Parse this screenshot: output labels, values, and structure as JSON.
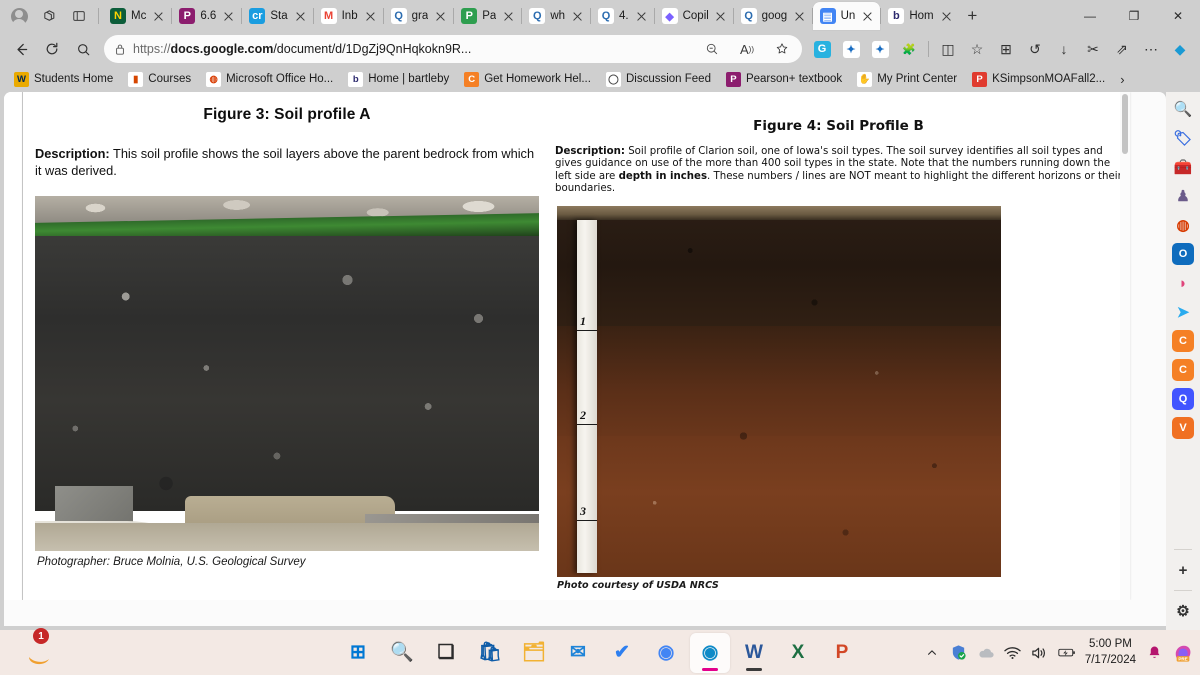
{
  "browser": {
    "tabs": [
      {
        "id": "t1",
        "favicon": "notion-icon",
        "fav_text": "N",
        "fav_bg": "#0c5d3a",
        "fav_fg": "#ffd400",
        "title": "Mc"
      },
      {
        "id": "t2",
        "favicon": "pearson-icon",
        "fav_text": "P",
        "fav_bg": "#8c1d6e",
        "fav_fg": "#ffffff",
        "title": "6.6"
      },
      {
        "id": "t3",
        "favicon": "course-hero-icon",
        "fav_text": "cr",
        "fav_bg": "#1a9de0",
        "fav_fg": "#ffffff",
        "title": "Sta"
      },
      {
        "id": "t4",
        "favicon": "gmail-icon",
        "fav_text": "M",
        "fav_bg": "#ffffff",
        "fav_fg": "#ea4335",
        "title": "Inb"
      },
      {
        "id": "t5",
        "favicon": "search-icon",
        "fav_text": "Q",
        "fav_bg": "#ffffff",
        "fav_fg": "#2b6cb0",
        "title": "gra"
      },
      {
        "id": "t6",
        "favicon": "paper-icon",
        "fav_text": "P",
        "fav_bg": "#2e9e4f",
        "fav_fg": "#ffffff",
        "title": "Pa"
      },
      {
        "id": "t7",
        "favicon": "search-icon",
        "fav_text": "Q",
        "fav_bg": "#ffffff",
        "fav_fg": "#2b6cb0",
        "title": "wh"
      },
      {
        "id": "t8",
        "favicon": "search-icon",
        "fav_text": "Q",
        "fav_bg": "#ffffff",
        "fav_fg": "#2b6cb0",
        "title": "4."
      },
      {
        "id": "t9",
        "favicon": "copilot-icon",
        "fav_text": "◆",
        "fav_bg": "#ffffff",
        "fav_fg": "#7b61ff",
        "title": "Copilot"
      },
      {
        "id": "t10",
        "favicon": "search-icon",
        "fav_text": "Q",
        "fav_bg": "#ffffff",
        "fav_fg": "#2b6cb0",
        "title": "google"
      },
      {
        "id": "t11",
        "favicon": "google-docs-icon",
        "fav_text": "▤",
        "fav_bg": "#4285f4",
        "fav_fg": "#ffffff",
        "title": "Un",
        "active": true
      },
      {
        "id": "t12",
        "favicon": "bartleby-icon",
        "fav_text": "b",
        "fav_bg": "#ffffff",
        "fav_fg": "#2d2a6e",
        "title": "Home |"
      }
    ],
    "new_tab_label": "+",
    "window_controls": {
      "minimize": "—",
      "maximize": "❐",
      "close": "✕"
    },
    "nav": {
      "back": "←",
      "refresh": "⟳",
      "search": "🔍",
      "url_prefix": "https://",
      "url_domain": "docs.google.com",
      "url_path": "/document/d/1DgZj9QnHqkokn9R...",
      "lock_icon": "lock-icon",
      "zoom_out_icon": "zoom-out-icon",
      "read_aloud_icon": "read-aloud-icon",
      "favorite_icon": "star-icon"
    },
    "extensions": [
      {
        "name": "grammarly-extension-icon",
        "glyph": "G",
        "bg": "#28b2e0",
        "fg": "#ffffff"
      },
      {
        "name": "extension-blue-icon-1",
        "glyph": "✦",
        "bg": "#ffffff",
        "fg": "#1b6ec2"
      },
      {
        "name": "extension-blue-icon-2",
        "glyph": "✦",
        "bg": "#ffffff",
        "fg": "#1b6ec2"
      },
      {
        "name": "extensions-puzzle-icon",
        "glyph": "🧩",
        "bg": "transparent",
        "fg": "#2f2f2f"
      }
    ],
    "toolbar_icons": [
      {
        "name": "split-screen-icon",
        "glyph": "◫"
      },
      {
        "name": "collections-icon",
        "glyph": "☆"
      },
      {
        "name": "add-tab-group-icon",
        "glyph": "⊞"
      },
      {
        "name": "history-icon",
        "glyph": "↺"
      },
      {
        "name": "downloads-icon",
        "glyph": "↓"
      },
      {
        "name": "screenshot-icon",
        "glyph": "✂"
      },
      {
        "name": "share-icon",
        "glyph": "⇗"
      },
      {
        "name": "settings-more-icon",
        "glyph": "⋯"
      },
      {
        "name": "copilot-icon",
        "glyph": "◆"
      }
    ],
    "bookmarks": [
      {
        "label": "Students Home",
        "icon": "wvu-icon",
        "glyph": "W",
        "bg": "#eaaa00",
        "fg": "#002855"
      },
      {
        "label": "Courses",
        "icon": "courses-icon",
        "glyph": "▮",
        "bg": "#ffffff",
        "fg": "#d64500"
      },
      {
        "label": "Microsoft Office Ho...",
        "icon": "office-icon",
        "glyph": "◍",
        "bg": "#ffffff",
        "fg": "#d83b01"
      },
      {
        "label": "Home | bartleby",
        "icon": "bartleby-icon",
        "glyph": "b",
        "bg": "#ffffff",
        "fg": "#2d2a6e"
      },
      {
        "label": "Get Homework Hel...",
        "icon": "chegg-icon",
        "glyph": "C",
        "bg": "#f58025",
        "fg": "#ffffff"
      },
      {
        "label": "Discussion Feed",
        "icon": "discussion-icon",
        "glyph": "◯",
        "bg": "#ffffff",
        "fg": "#4a4a4a"
      },
      {
        "label": "Pearson+ textbook",
        "icon": "pearson-icon",
        "glyph": "P",
        "bg": "#8c1d6e",
        "fg": "#ffffff"
      },
      {
        "label": "My Print Center",
        "icon": "print-center-icon",
        "glyph": "✋",
        "bg": "#ffffff",
        "fg": "#f5a623"
      },
      {
        "label": "KSimpsonMOAFall2...",
        "icon": "pdf-icon",
        "glyph": "P",
        "bg": "#e03b2f",
        "fg": "#ffffff"
      }
    ],
    "bookmarks_overflow": "›"
  },
  "sidebar": {
    "items": [
      {
        "name": "search-sidebar-icon",
        "glyph": "🔍",
        "bg": "transparent",
        "fg": "#3a3a3a"
      },
      {
        "name": "shopping-tag-icon",
        "glyph": "🏷",
        "bg": "transparent",
        "fg": "#3b6fe0"
      },
      {
        "name": "tools-icon",
        "glyph": "🧰",
        "bg": "transparent",
        "fg": "#d4482a"
      },
      {
        "name": "games-icon",
        "glyph": "♟",
        "bg": "transparent",
        "fg": "#6b5b8a"
      },
      {
        "name": "office-icon",
        "glyph": "◍",
        "bg": "transparent",
        "fg": "#d83b01"
      },
      {
        "name": "outlook-icon",
        "glyph": "O",
        "bg": "#0f6cbd",
        "fg": "#ffffff"
      },
      {
        "name": "designer-icon",
        "glyph": "◗",
        "bg": "transparent",
        "fg": "#e0457b"
      },
      {
        "name": "telegram-icon",
        "glyph": "➤",
        "bg": "transparent",
        "fg": "#2aabee"
      },
      {
        "name": "chegg-icon-1",
        "glyph": "C",
        "bg": "#f58025",
        "fg": "#ffffff"
      },
      {
        "name": "chegg-icon-2",
        "glyph": "C",
        "bg": "#f58025",
        "fg": "#ffffff"
      },
      {
        "name": "quizlet-icon",
        "glyph": "Q",
        "bg": "#4255ff",
        "fg": "#ffffff"
      },
      {
        "name": "vimeo-icon",
        "glyph": "V",
        "bg": "#f07022",
        "fg": "#ffffff"
      }
    ],
    "add_label": "+",
    "settings_label": "⚙"
  },
  "document": {
    "figure_a": {
      "title": "Figure 3:  Soil profile A",
      "description_label": "Description:",
      "description_text": " This soil profile shows the soil layers above the parent bedrock from which it was derived.",
      "caption": "Photographer: Bruce Molnia, U.S. Geological Survey",
      "image_alt": "soil-profile-a-photo"
    },
    "figure_b": {
      "title": "Figure 4: Soil Profile B",
      "description_label": "Description:",
      "description_part1": " Soil profile of Clarion soil, one of Iowa's soil types. The soil survey identifies all soil types and gives guidance on use of the more than 400 soil types in the state. Note that the numbers running down the left side are ",
      "description_bold1": "depth in inches",
      "description_part2": ". These numbers / lines are NOT meant to highlight the different horizons or their boundaries.",
      "caption": "Photo courtesy of USDA NRCS",
      "image_alt": "soil-profile-b-photo",
      "ruler_marks": [
        "1",
        "2",
        "3"
      ]
    }
  },
  "taskbar": {
    "items": [
      {
        "name": "start-button",
        "glyph": "⊞",
        "color": "#0078d4"
      },
      {
        "name": "taskbar-search-icon",
        "glyph": "🔍",
        "color": "#1b1b1b"
      },
      {
        "name": "task-view-icon",
        "glyph": "❏",
        "color": "#2b2b2b"
      },
      {
        "name": "microsoft-store-icon",
        "glyph": "🛍",
        "color": "#0e5ca8"
      },
      {
        "name": "file-explorer-icon",
        "glyph": "🗂",
        "color": "#f2b233"
      },
      {
        "name": "mail-icon",
        "glyph": "✉",
        "color": "#1f84d8"
      },
      {
        "name": "todo-icon",
        "glyph": "✔",
        "color": "#2d7ff0"
      },
      {
        "name": "chrome-icon",
        "glyph": "◉",
        "color": "#4285f4"
      },
      {
        "name": "edge-icon",
        "glyph": "◉",
        "color": "#0f8ac7",
        "highlight": true,
        "underline": "#e3008c"
      },
      {
        "name": "word-icon",
        "glyph": "W",
        "color": "#2b579a",
        "underline": "#3a3a3a"
      },
      {
        "name": "excel-icon",
        "glyph": "X",
        "color": "#1d6f42"
      },
      {
        "name": "powerpoint-icon",
        "glyph": "P",
        "color": "#d24726"
      }
    ],
    "notification_count": "1",
    "tray": [
      {
        "name": "show-hidden-icons-chevron",
        "glyph": "^"
      },
      {
        "name": "windows-security-icon",
        "glyph": "🛡"
      },
      {
        "name": "onedrive-icon",
        "glyph": "☁"
      },
      {
        "name": "wifi-icon",
        "glyph": "📶"
      },
      {
        "name": "volume-icon",
        "glyph": "🔊"
      },
      {
        "name": "battery-icon",
        "glyph": "🔋"
      }
    ],
    "clock_time": "5:00 PM",
    "clock_date": "7/17/2024",
    "notification_bell": "🔔",
    "copilot_label": "PRE"
  }
}
